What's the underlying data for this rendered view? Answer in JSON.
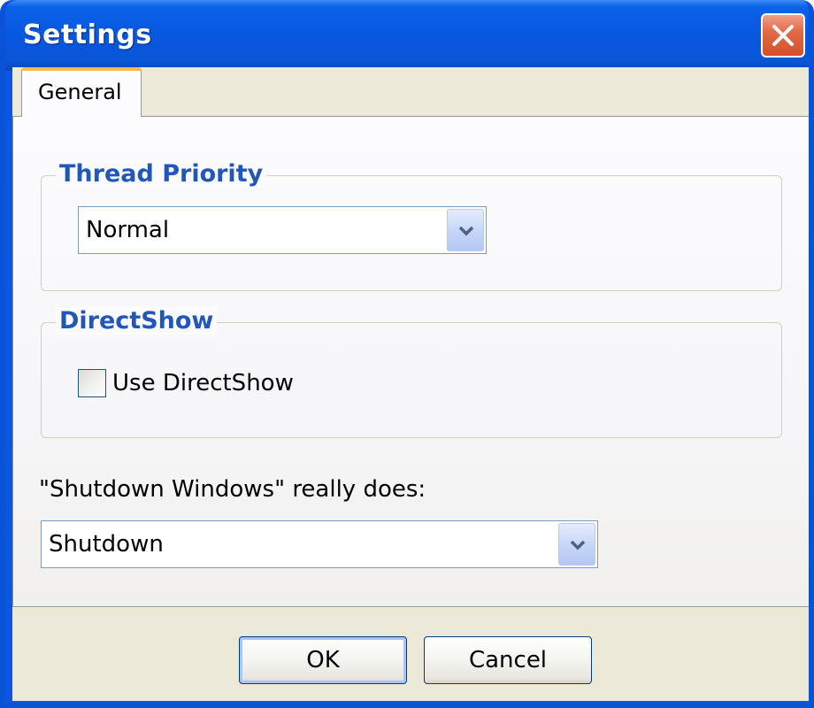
{
  "window": {
    "title": "Settings",
    "close_icon": "close-icon"
  },
  "tabs": [
    {
      "label": "General",
      "selected": true
    }
  ],
  "thread_priority": {
    "legend": "Thread Priority",
    "selected": "Normal"
  },
  "directshow": {
    "legend": "DirectShow",
    "checkbox_label": "Use DirectShow",
    "checked": false
  },
  "shutdown": {
    "label": "\"Shutdown Windows\" really does:",
    "selected": "Shutdown"
  },
  "buttons": {
    "ok": "OK",
    "cancel": "Cancel"
  },
  "colors": {
    "titlebar": "#0757df",
    "legend_text": "#2157b8",
    "close_button": "#e26a48"
  }
}
